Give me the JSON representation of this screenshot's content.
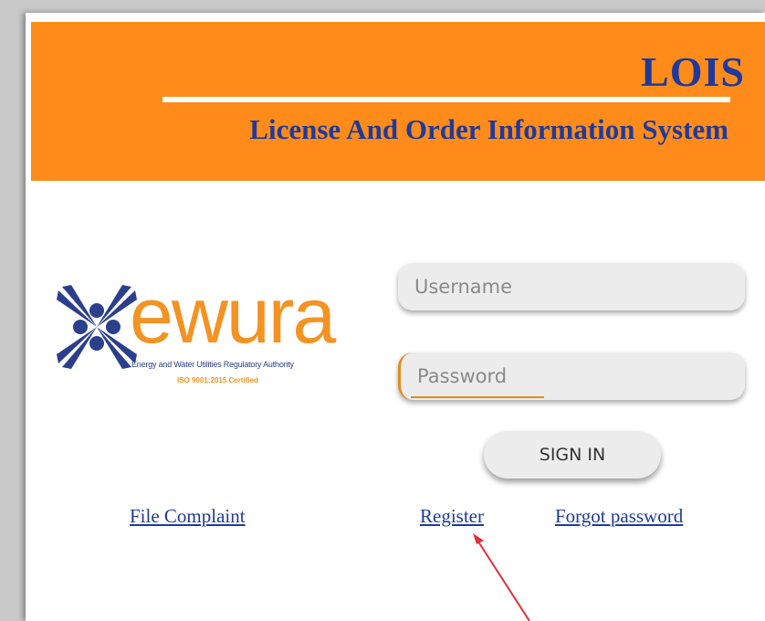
{
  "header": {
    "app_short_name": "LOIS",
    "app_full_name": "License And Order Information System",
    "background_color": "#ff8c1a",
    "title_color": "#1f3a9c"
  },
  "logo": {
    "wordmark": "ewura",
    "tagline": "Energy and Water Utilities Regulatory Authority",
    "certification": "ISO 9001:2015 Certified",
    "icon": "ewura-star-logo-icon"
  },
  "login_form": {
    "username_placeholder": "Username",
    "username_value": "",
    "password_placeholder": "Password",
    "password_value": "",
    "signin_label": "SIGN IN"
  },
  "links": {
    "file_complaint": "File Complaint",
    "register": "Register",
    "forgot_password": "Forgot password"
  },
  "annotation": {
    "icon": "red-arrow-icon",
    "color": "#e0303a"
  }
}
